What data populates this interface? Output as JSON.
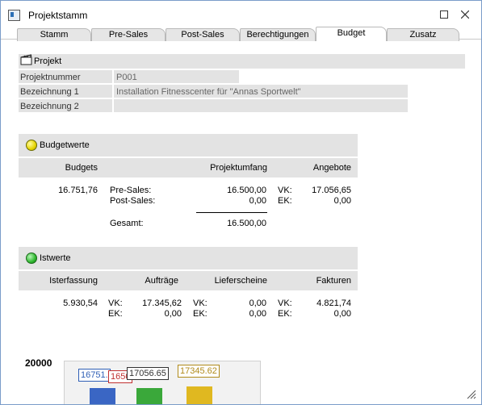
{
  "window": {
    "title": "Projektstamm"
  },
  "tabs": [
    {
      "label": "Stamm"
    },
    {
      "label": "Pre-Sales"
    },
    {
      "label": "Post-Sales"
    },
    {
      "label": "Berechtigungen"
    },
    {
      "label": "Budget"
    },
    {
      "label": "Zusatz"
    }
  ],
  "active_tab": "Budget",
  "projekt": {
    "section_label": "Projekt",
    "rows": [
      {
        "label": "Projektnummer",
        "value": "P001"
      },
      {
        "label": "Bezeichnung 1",
        "value": "Installation Fitnesscenter für \"Annas Sportwelt\""
      },
      {
        "label": "Bezeichnung 2",
        "value": ""
      }
    ]
  },
  "budgetwerte": {
    "section_label": "Budgetwerte",
    "lamp_color": "#f0e020",
    "headers": {
      "budgets": "Budgets",
      "projektumfang": "Projektumfang",
      "angebote": "Angebote"
    },
    "budget_value": "16.751,76",
    "pre_sales_label": "Pre-Sales:",
    "pre_sales_value": "16.500,00",
    "post_sales_label": "Post-Sales:",
    "post_sales_value": "0,00",
    "gesamt_label": "Gesamt:",
    "gesamt_value": "16.500,00",
    "vk_label": "VK:",
    "vk_value": "17.056,65",
    "ek_label": "EK:",
    "ek_value": "0,00"
  },
  "istwerte": {
    "section_label": "Istwerte",
    "lamp_color": "#2fb82f",
    "headers": {
      "isterfassung": "Isterfassung",
      "auftraege": "Aufträge",
      "lieferscheine": "Lieferscheine",
      "fakturen": "Fakturen"
    },
    "isterfassung_value": "5.930,54",
    "auftraege": {
      "vk_label": "VK:",
      "vk": "17.345,62",
      "ek_label": "EK:",
      "ek": "0,00"
    },
    "lieferscheine": {
      "vk_label": "VK:",
      "vk": "0,00",
      "ek_label": "EK:",
      "ek": "0,00"
    },
    "fakturen": {
      "vk_label": "VK:",
      "vk": "4.821,74",
      "ek_label": "EK:",
      "ek": "0,00"
    }
  },
  "chart": {
    "axis_label": "20000",
    "labels": [
      {
        "text": "16751.",
        "color": "#2f5fb5"
      },
      {
        "text": "1650",
        "color": "#c03030"
      },
      {
        "text": "17056.65",
        "color": "#333333"
      },
      {
        "text": "17345.62",
        "color": "#b08a1a"
      }
    ]
  }
}
